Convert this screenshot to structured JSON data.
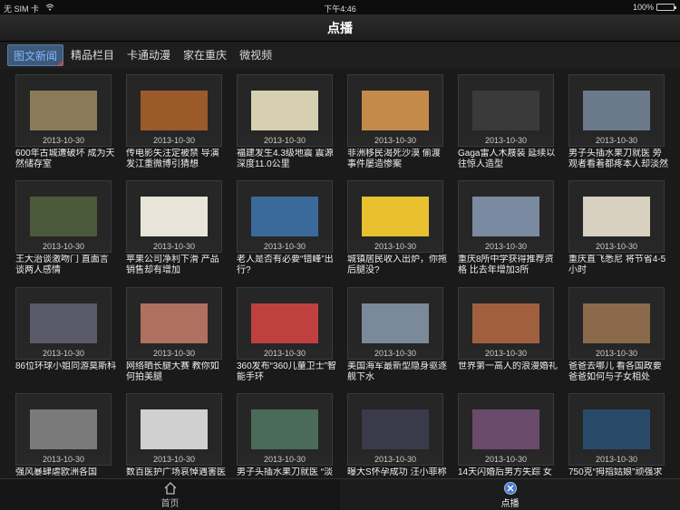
{
  "status": {
    "carrier": "无 SIM 卡",
    "time": "下午4:46",
    "battery": "100%",
    "battery_level": 1.0
  },
  "nav": {
    "title": "点播"
  },
  "tabs": [
    {
      "label": "图文新闻",
      "active": true
    },
    {
      "label": "精品栏目",
      "active": false
    },
    {
      "label": "卡通动漫",
      "active": false
    },
    {
      "label": "家在重庆",
      "active": false
    },
    {
      "label": "微视频",
      "active": false
    }
  ],
  "items": [
    {
      "date": "2013-10-30",
      "caption": "600年古城遭破坏 成为天然储存室",
      "img": "#8a7a5a"
    },
    {
      "date": "2013-10-30",
      "caption": "传电影失注定被禁 导演发江重微博引猜想",
      "img": "#9b5a2a"
    },
    {
      "date": "2013-10-30",
      "caption": "福建发生4.3级地震 震源深度11.0公里",
      "img": "#d6d0b0"
    },
    {
      "date": "2013-10-30",
      "caption": "非洲移民渴死沙漠 偷渡事件屡造惨案",
      "img": "#c48a4a"
    },
    {
      "date": "2013-10-30",
      "caption": "Gaga雷人木屐装 延续以往惊人造型",
      "img": "#3a3a3a"
    },
    {
      "date": "2013-10-30",
      "caption": "男子头插水果刀就医 旁观者看着都疼本人却淡然",
      "img": "#6a7a8a"
    },
    {
      "date": "2013-10-30",
      "caption": "王大治谈激吻门 直面言谈两人感情",
      "img": "#4a5a3a"
    },
    {
      "date": "2013-10-30",
      "caption": "苹果公司净利下滑 产品销售却有增加",
      "img": "#e8e4d8"
    },
    {
      "date": "2013-10-30",
      "caption": "老人是否有必要“错峰”出行?",
      "img": "#3a6a9a"
    },
    {
      "date": "2013-10-30",
      "caption": "城镇居民收入出炉，你拖后腿没?",
      "img": "#e8c030"
    },
    {
      "date": "2013-10-30",
      "caption": "重庆8所中学获得推荐资格 比去年增加3所",
      "img": "#7a8aa0"
    },
    {
      "date": "2013-10-30",
      "caption": "重庆直飞悉尼 将节省4-5小时",
      "img": "#d8d0c0"
    },
    {
      "date": "2013-10-30",
      "caption": "86位环球小姐同游莫斯科",
      "img": "#5a5a6a"
    },
    {
      "date": "2013-10-30",
      "caption": "网络晒长腿大赛 教你如何拍美腿",
      "img": "#b07060"
    },
    {
      "date": "2013-10-30",
      "caption": "360发布“360儿童卫士”智能手环",
      "img": "#c04040"
    },
    {
      "date": "2013-10-30",
      "caption": "美国海军最新型隐身驱逐舰下水",
      "img": "#7a8a9a"
    },
    {
      "date": "2013-10-30",
      "caption": "世界第一高人的浪漫婚礼",
      "img": "#a06040"
    },
    {
      "date": "2013-10-30",
      "caption": "爸爸去哪儿 看各国政要爸爸如何与子女相处",
      "img": "#8a6a4a"
    },
    {
      "date": "2013-10-30",
      "caption": "强风暴肆虐欧洲各国",
      "img": "#7a7a7a"
    },
    {
      "date": "2013-10-30",
      "caption": "数百医护广场哀悼遇害医",
      "img": "#d0d0d0"
    },
    {
      "date": "2013-10-30",
      "caption": "男子头插水果刀就医 “淡",
      "img": "#4a6a5a"
    },
    {
      "date": "2013-10-30",
      "caption": "曝大S怀孕成功 汪小菲称",
      "img": "#3a3a4a"
    },
    {
      "date": "2013-10-30",
      "caption": "14天闪婚后男方失踪 女",
      "img": "#6a4a6a"
    },
    {
      "date": "2013-10-30",
      "caption": "750克“拇指姑娘”顽强求",
      "img": "#2a4a6a"
    }
  ],
  "bottom_tabs": [
    {
      "label": "首页",
      "icon": "home-icon",
      "active": false
    },
    {
      "label": "点播",
      "icon": "play-icon",
      "active": true
    }
  ]
}
